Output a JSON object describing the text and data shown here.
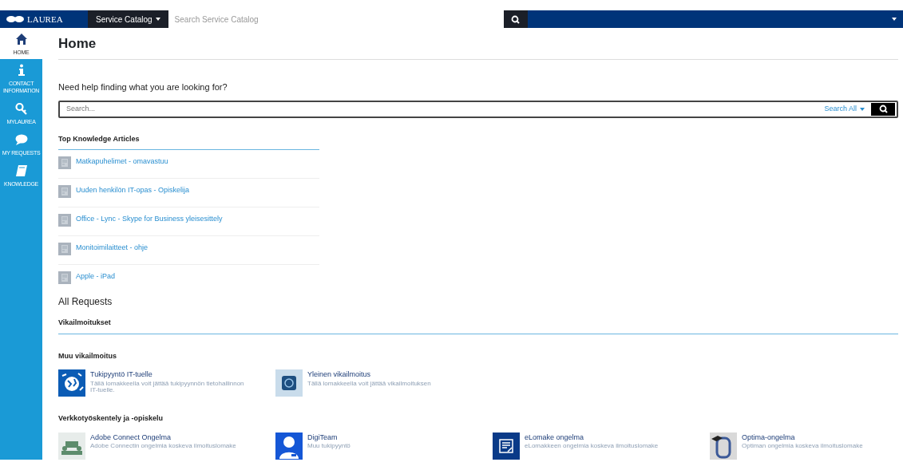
{
  "navbar": {
    "brand": "LAUREA",
    "catalog_menu": "Service Catalog",
    "search": {
      "placeholder": "Search Service Catalog"
    }
  },
  "sidebar": {
    "items": [
      {
        "label": "HOME",
        "selected": true
      },
      {
        "label": "CONTACT INFORMATION",
        "selected": false
      },
      {
        "label": "MYLAUREA",
        "selected": false
      },
      {
        "label": "MY REQUESTS",
        "selected": false
      },
      {
        "label": "KNOWLEDGE",
        "selected": false
      }
    ]
  },
  "page": {
    "title": "Home",
    "help_text": "Need help finding what you are looking for?",
    "search": {
      "placeholder": "Search...",
      "scope": "Search All"
    }
  },
  "knowledge": {
    "title": "Top Knowledge Articles",
    "articles": [
      "Matkapuhelimet - omavastuu",
      "Uuden henkilön IT-opas - Opiskelija",
      "Office - Lync - Skype for Business yleisesittely",
      "Monitoimilaitteet - ohje",
      "Apple - iPad"
    ]
  },
  "requests": {
    "title": "All Requests",
    "category": "Vikailmoitukset",
    "groups": [
      {
        "title": "Muu vikailmoitus",
        "items": [
          {
            "name": "Tukipyyntö IT-tuelle",
            "description": "Tällä lomakkeella voit jättää tukipyynnön tietohallinnon IT-tuelle."
          },
          {
            "name": "Yleinen vikailmoitus",
            "description": "Tällä lomakkeella voit jättää vikailmoituksen"
          }
        ]
      },
      {
        "title": "Verkkotyöskentely ja -opiskelu",
        "items": [
          {
            "name": "Adobe Connect Ongelma",
            "description": "Adobe Connectin ongelmia koskeva ilmoituslomake"
          },
          {
            "name": "DigiTeam",
            "description": "Muu tukipyyntö"
          },
          {
            "name": "eLomake ongelma",
            "description": "eLomakkeen ongelmia koskeva ilmoituslomake"
          },
          {
            "name": "Optima-ongelma",
            "description": "Optiman ongelmia koskeva ilmoituslomake"
          }
        ]
      }
    ]
  }
}
